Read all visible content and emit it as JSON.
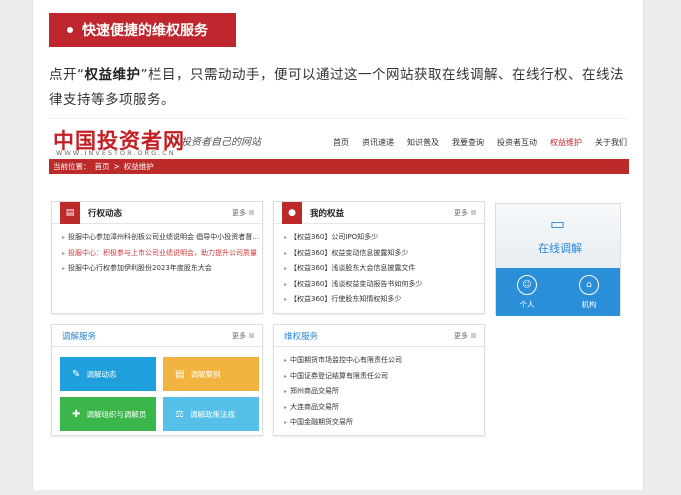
{
  "banner": {
    "label": "快速便捷的维权服务"
  },
  "paragraph": {
    "lead": "点开“",
    "bold": "权益维护",
    "rest": "”栏目，只需动动手，便可以通过这一个网站获取在线调解、在线行权、在线法律支持等多项服务。"
  },
  "site": {
    "logo": "中国投资者网",
    "logo_url": "WWW.INVESTOR.ORG.CN",
    "slogan": "投资者自己的网站",
    "nav": [
      "首页",
      "资讯速递",
      "知识普及",
      "我要查询",
      "投资者互动",
      "权益维护",
      "关于我们"
    ],
    "nav_active": "权益维护",
    "breadcrumb": {
      "prefix": "当前位置：",
      "home": "首页",
      "sep": ">",
      "current": "权益维护"
    }
  },
  "cards": {
    "more": "更多",
    "xingquan": {
      "title": "行权动态",
      "items": [
        {
          "text": "投服中心参加漳州科创板公司业绩说明会 倡导中小投资者督…",
          "red": false
        },
        {
          "text": "投服中心：积极参与上市公司业绩说明会，助力提升公司质量",
          "red": true
        },
        {
          "text": "投服中心行权参加伊利股份2023年度股东大会",
          "red": false
        }
      ]
    },
    "quanyi": {
      "title": "我的权益",
      "items": [
        "【权益360】公司IPO知多少",
        "【权益360】权益变动信息披露知多少",
        "【权益360】浅谈股东大会信息披露文件",
        "【权益360】浅谈权益变动报告书如何多少",
        "【权益360】行使股东知情权知多少"
      ]
    },
    "tiaojie": {
      "title": "调解服务",
      "tiles": [
        {
          "label": "调解动态",
          "color": "#1f9fdb",
          "icon": "✎"
        },
        {
          "label": "调解案例",
          "color": "#f2b440",
          "icon": "▤"
        },
        {
          "label": "调解组织与调解员",
          "color": "#3bb64a",
          "icon": "✚"
        },
        {
          "label": "调解政策法规",
          "color": "#56c0e8",
          "icon": "⚖"
        }
      ]
    },
    "weiquan": {
      "title": "维权服务",
      "items": [
        "中国期货市场监控中心有限责任公司",
        "中国证券登记结算有限责任公司",
        "郑州商品交易所",
        "大连商品交易所",
        "中国金融期货交易所"
      ]
    }
  },
  "online": {
    "label": "在线调解",
    "person": "个人",
    "org": "机构"
  }
}
